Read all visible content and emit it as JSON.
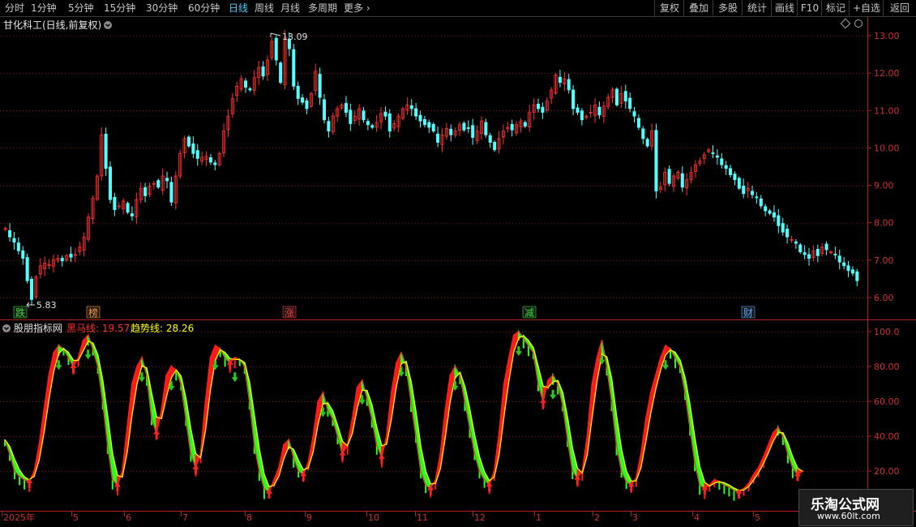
{
  "toolbar": {
    "periods": [
      {
        "label": "分时",
        "active": false
      },
      {
        "label": "1分钟",
        "active": false
      },
      {
        "label": "5分钟",
        "active": false
      },
      {
        "label": "15分钟",
        "active": false
      },
      {
        "label": "30分钟",
        "active": false
      },
      {
        "label": "60分钟",
        "active": false
      },
      {
        "label": "日线",
        "active": true
      },
      {
        "label": "周线",
        "active": false
      },
      {
        "label": "月线",
        "active": false
      },
      {
        "label": "多周期",
        "active": false
      },
      {
        "label": "更多",
        "active": false
      }
    ],
    "actions": [
      "复权",
      "叠加",
      "多股",
      "统计",
      "画线",
      "F10",
      "标记",
      "+自选",
      "返回"
    ]
  },
  "main_chart": {
    "title": "甘化科工(日线,前复权)",
    "price_axis": [
      "13.00",
      "12.00",
      "11.00",
      "10.00",
      "9.00",
      "8.00",
      "7.00",
      "6.00"
    ],
    "high_label": "13.09",
    "low_label": "5.83",
    "markers": [
      {
        "text": "跌",
        "color": "#33dd33"
      },
      {
        "text": "榜",
        "color": "#ff9933"
      },
      {
        "text": "涨",
        "color": "#ff3333"
      },
      {
        "text": "减",
        "color": "#33dd33"
      },
      {
        "text": "财",
        "color": "#4fa8ff"
      }
    ]
  },
  "indicator": {
    "name": "股朋指标网",
    "series": [
      {
        "name": "黑马线",
        "value": "19.57",
        "color": "#ff3030"
      },
      {
        "name": "趋势线",
        "value": "28.26",
        "color": "#ffff00"
      }
    ],
    "axis": [
      "100.0",
      "80.00",
      "60.00",
      "40.00",
      "20.00"
    ]
  },
  "date_axis": [
    "2025年",
    "5",
    "6",
    "7",
    "8",
    "9",
    "10",
    "11",
    "12",
    "1",
    "2",
    "3",
    "4",
    "5"
  ],
  "watermark": {
    "title": "乐淘公式网",
    "url": "www.60lt.com"
  },
  "colors": {
    "up": "#ff3232",
    "down": "#54ffff",
    "grid": "#8b1a1a",
    "axis": "#b22222",
    "k_line": "#ff2020",
    "d_line": "#ffff00",
    "fill_up": "#ff1a1a",
    "fill_down": "#22ff22"
  },
  "chart_data": [
    {
      "type": "candlestick",
      "title": "甘化科工(日线,前复权)",
      "ylim": [
        5.6,
        13.3
      ],
      "y_ticks": [
        13,
        12,
        11,
        10,
        9,
        8,
        7,
        6
      ],
      "x_months": [
        "2025年",
        "5",
        "6",
        "7",
        "8",
        "9",
        "10",
        "11",
        "12",
        "1",
        "2",
        "3",
        "4",
        "5"
      ],
      "annotations": {
        "high": 13.09,
        "low": 5.83
      },
      "close": [
        7.85,
        7.62,
        7.48,
        7.25,
        7.05,
        6.45,
        5.95,
        6.55,
        6.85,
        6.92,
        6.88,
        7.02,
        7.05,
        6.98,
        7.12,
        7.08,
        7.15,
        7.35,
        7.62,
        8.15,
        8.65,
        9.25,
        10.35,
        9.45,
        8.62,
        8.35,
        8.45,
        8.58,
        8.28,
        8.18,
        8.62,
        8.92,
        8.72,
        8.98,
        9.05,
        8.95,
        9.25,
        9.12,
        8.55,
        9.25,
        9.85,
        10.25,
        10.05,
        9.85,
        9.72,
        9.75,
        9.78,
        9.62,
        9.55,
        9.85,
        10.45,
        10.85,
        11.32,
        11.65,
        11.85,
        11.62,
        11.55,
        11.88,
        12.15,
        11.92,
        12.35,
        12.85,
        12.35,
        11.75,
        12.95,
        12.65,
        11.65,
        11.32,
        11.22,
        11.05,
        11.45,
        12.05,
        11.35,
        10.75,
        10.45,
        10.85,
        11.05,
        11.15,
        10.95,
        10.65,
        10.85,
        11.05,
        10.75,
        10.62,
        10.55,
        10.68,
        10.92,
        10.85,
        10.45,
        10.65,
        10.85,
        11.05,
        11.15,
        11.05,
        10.85,
        10.72,
        10.62,
        10.55,
        10.45,
        10.15,
        10.35,
        10.52,
        10.35,
        10.45,
        10.62,
        10.48,
        10.52,
        10.28,
        10.45,
        10.72,
        10.35,
        10.15,
        9.95,
        10.25,
        10.45,
        10.55,
        10.48,
        10.62,
        10.72,
        10.58,
        10.95,
        11.15,
        11.05,
        10.95,
        11.25,
        11.55,
        11.95,
        11.75,
        11.85,
        11.55,
        11.05,
        10.95,
        10.75,
        10.85,
        10.95,
        11.15,
        10.88,
        11.12,
        11.35,
        11.55,
        11.15,
        11.45,
        11.25,
        11.05,
        10.85,
        10.55,
        10.25,
        10.05,
        10.45,
        8.85,
        8.95,
        9.35,
        9.05,
        9.25,
        9.35,
        8.95,
        9.15,
        9.35,
        9.55,
        9.65,
        9.82,
        9.95,
        9.85,
        9.75,
        9.55,
        9.45,
        9.28,
        9.15,
        8.92,
        8.78,
        8.92,
        8.75,
        8.68,
        8.45,
        8.32,
        8.25,
        8.15,
        7.92,
        7.75,
        7.62,
        7.55,
        7.45,
        7.22,
        7.15,
        7.05,
        7.25,
        7.12,
        7.35,
        7.28,
        7.22,
        7.15,
        6.95,
        6.85,
        6.72,
        6.65,
        6.45
      ]
    },
    {
      "type": "area",
      "title": "股朋指标网",
      "ylim": [
        0,
        105
      ],
      "y_ticks": [
        100,
        80,
        60,
        40,
        20
      ],
      "series": [
        {
          "name": "黑马线",
          "role": "K",
          "last": 19.57
        },
        {
          "name": "趋势线",
          "role": "D",
          "last": 28.26
        }
      ],
      "k": [
        38,
        30,
        20,
        17,
        15,
        14,
        20,
        35,
        55,
        75,
        88,
        92,
        90,
        85,
        80,
        85,
        95,
        98,
        90,
        80,
        60,
        35,
        15,
        12,
        20,
        45,
        70,
        80,
        85,
        75,
        50,
        42,
        55,
        75,
        80,
        78,
        70,
        50,
        30,
        22,
        30,
        60,
        85,
        92,
        90,
        85,
        82,
        85,
        84,
        80,
        60,
        35,
        20,
        10,
        8,
        15,
        22,
        35,
        38,
        28,
        20,
        18,
        25,
        40,
        60,
        65,
        55,
        50,
        40,
        30,
        35,
        50,
        68,
        72,
        62,
        50,
        35,
        28,
        40,
        65,
        82,
        88,
        80,
        60,
        40,
        20,
        12,
        10,
        15,
        30,
        55,
        75,
        80,
        75,
        60,
        45,
        30,
        20,
        15,
        12,
        20,
        42,
        70,
        85,
        98,
        100,
        96,
        92,
        88,
        70,
        60,
        72,
        75,
        70,
        58,
        38,
        20,
        16,
        20,
        40,
        70,
        85,
        95,
        80,
        60,
        35,
        20,
        14,
        12,
        16,
        30,
        50,
        65,
        75,
        85,
        92,
        90,
        85,
        80,
        65,
        45,
        25,
        12,
        10,
        12,
        15,
        14,
        12,
        11,
        9,
        8,
        10,
        13,
        18,
        22,
        28,
        35,
        42,
        45,
        40,
        30,
        22,
        18,
        20
      ]
    },
    {
      "type": "table",
      "series": [
        {
          "name": "黑马线",
          "value": 19.57
        },
        {
          "name": "趋势线",
          "value": 28.26
        }
      ]
    }
  ]
}
